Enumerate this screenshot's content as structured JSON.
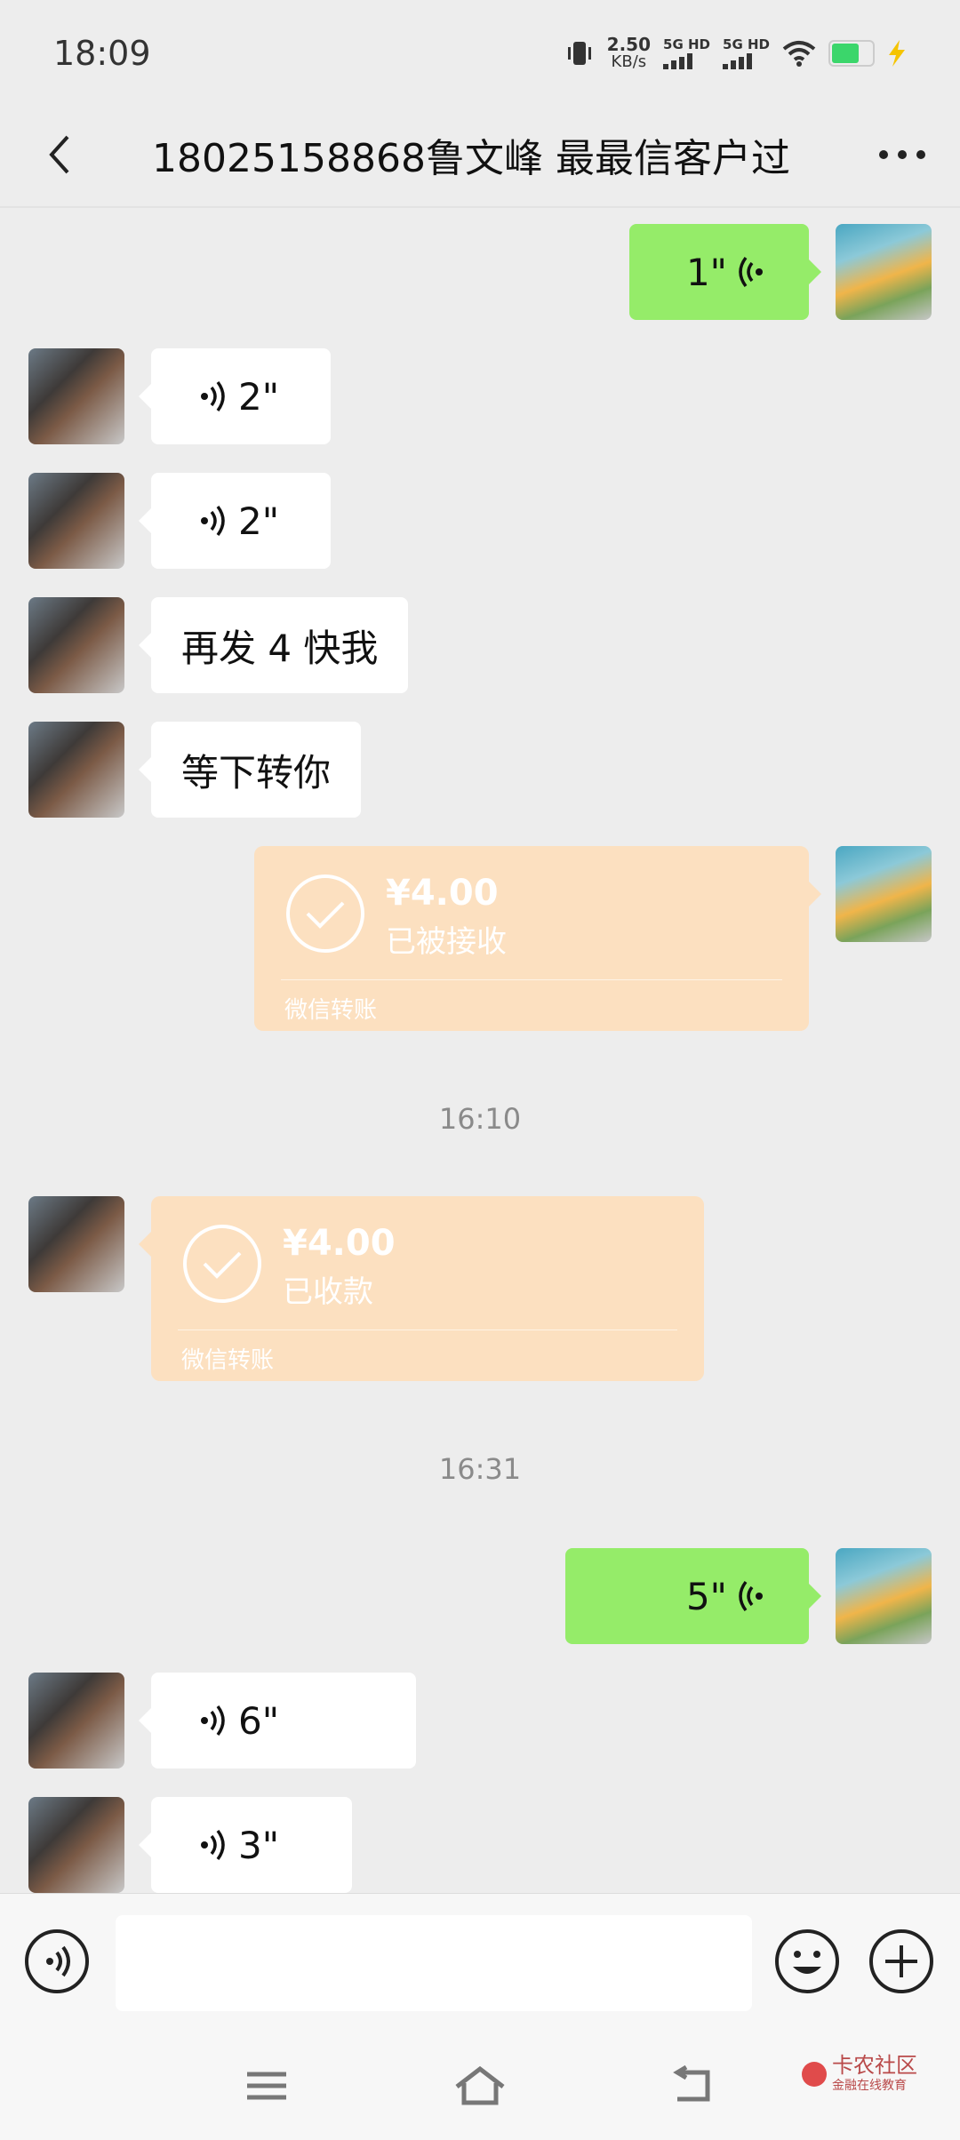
{
  "status_bar": {
    "time": "18:09",
    "net_speed_value": "2.50",
    "net_speed_unit": "KB/s",
    "sim1_label": "5G HD",
    "sim2_label": "5G HD"
  },
  "header": {
    "title": "18025158868鲁文峰 最最信客户过"
  },
  "messages": {
    "m1": {
      "duration": "1\""
    },
    "m2": {
      "duration": "2\""
    },
    "m3": {
      "duration": "2\""
    },
    "m4": {
      "text": "再发 4 快我"
    },
    "m5": {
      "text": "等下转你"
    },
    "m6": {
      "amount": "¥4.00",
      "status": "已被接收",
      "source": "微信转账"
    },
    "time1": "16:10",
    "m7": {
      "amount": "¥4.00",
      "status": "已收款",
      "source": "微信转账"
    },
    "time2": "16:31",
    "m8": {
      "duration": "5\""
    },
    "m9": {
      "duration": "6\""
    },
    "m10": {
      "duration": "3\""
    }
  },
  "input_bar": {
    "value": ""
  },
  "watermark": {
    "name": "卡农社区",
    "tagline": "金融在线教育"
  },
  "colors": {
    "chat_background": "#ededed",
    "self_bubble": "#95ec69",
    "other_bubble": "#ffffff",
    "transfer_bubble": "#fce0c0"
  }
}
